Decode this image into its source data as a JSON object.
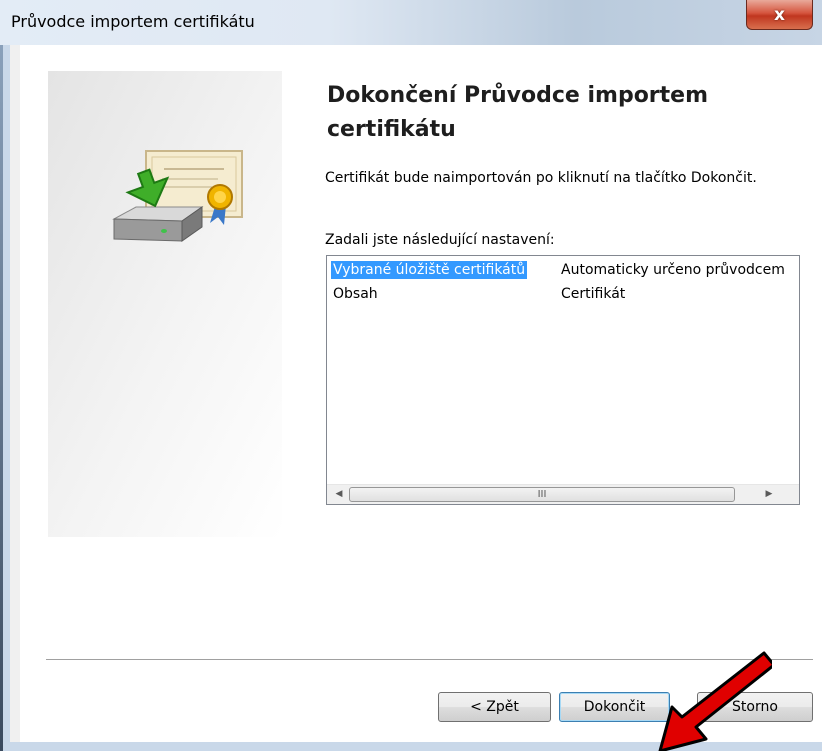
{
  "window": {
    "title": "Průvodce importem certifikátu",
    "close_label": "x"
  },
  "heading": "Dokončení Průvodce importem certifikátu",
  "description": "Certifikát bude naimportován po kliknutí na tlačítko Dokončit.",
  "settings_label": "Zadali jste následující nastavení:",
  "settings": [
    {
      "name": "Vybrané úložiště certifikátů",
      "value": "Automaticky určeno průvodcem",
      "selected": true
    },
    {
      "name": "Obsah",
      "value": "Certifikát",
      "selected": false
    }
  ],
  "scrollbar": {
    "thumb_grip": "III"
  },
  "buttons": {
    "back": "< Zpět",
    "finish": "Dokončit",
    "cancel": "Storno"
  },
  "colors": {
    "selection": "#3399ff",
    "annotation_arrow": "#e00000"
  }
}
